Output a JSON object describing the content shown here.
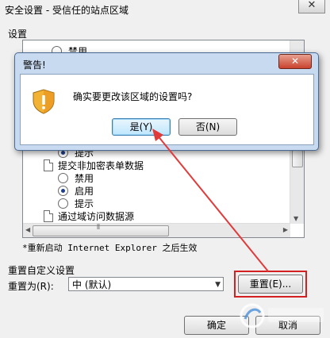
{
  "window": {
    "title": "安全设置 - 受信任的站点区域",
    "close_glyph": "✕"
  },
  "settings": {
    "label": "设置",
    "tree_items": [
      {
        "kind": "radio",
        "label": "禁用",
        "checked": false
      },
      {
        "kind": "radio",
        "label": "提示",
        "checked": true
      },
      {
        "kind": "doc",
        "label": "提交非加密表单数据"
      },
      {
        "kind": "radio",
        "label": "禁用",
        "checked": false
      },
      {
        "kind": "radio",
        "label": "启用",
        "checked": true
      },
      {
        "kind": "radio",
        "label": "提示",
        "checked": false
      },
      {
        "kind": "doc",
        "label": "通过域访问数据源"
      }
    ],
    "restart_note": "*重新启动 Internet Explorer 之后生效"
  },
  "reset": {
    "group_label": "重置自定义设置",
    "reset_to_label": "重置为(R):",
    "selected_level": "中 (默认)",
    "reset_button": "重置(E)..."
  },
  "bottom_buttons": {
    "ok": "确定",
    "cancel": "取消"
  },
  "alert": {
    "title": "警告!",
    "message": "确实要更改该区域的设置吗?",
    "yes_button": "是(Y)",
    "no_button": "否(N)",
    "close_glyph": "✕",
    "icon": "shield-warning-icon"
  },
  "colors": {
    "annotation_red": "#e03a3a",
    "highlight_red": "#d42020"
  }
}
